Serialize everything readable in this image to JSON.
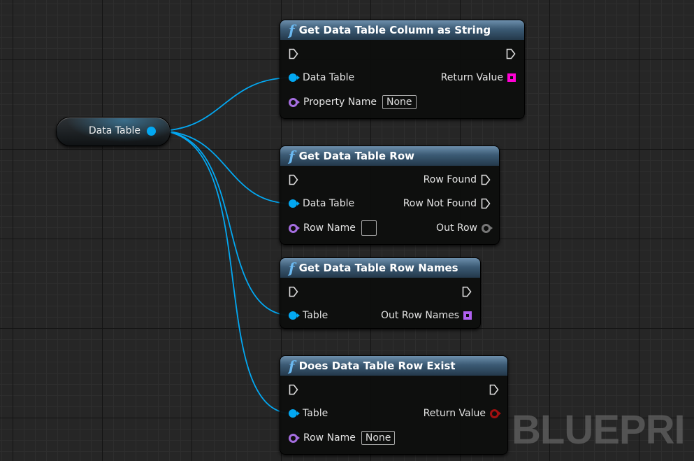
{
  "watermark": "BLUEPRI",
  "variable_node": {
    "label": "Data Table",
    "pin_color": "#03a8f2"
  },
  "nodes": [
    {
      "title": "Get Data Table Column as String",
      "inputs": [
        "Data Table",
        "Property Name"
      ],
      "property_value": "None",
      "outputs": [
        "Return Value"
      ]
    },
    {
      "title": "Get Data Table Row",
      "inputs": [
        "Data Table",
        "Row Name"
      ],
      "outputs": [
        "Row Found",
        "Row Not Found",
        "Out Row"
      ]
    },
    {
      "title": "Get Data Table Row Names",
      "inputs": [
        "Table"
      ],
      "outputs": [
        "Out Row Names"
      ]
    },
    {
      "title": "Does Data Table Row Exist",
      "inputs": [
        "Table",
        "Row Name"
      ],
      "row_name_value": "None",
      "outputs": [
        "Return Value"
      ]
    }
  ],
  "function_icon": "f",
  "colors": {
    "data_table_pin": "#03a8f2",
    "name_pin": "#a56ee0",
    "string_array": "#ff00d4",
    "name_array": "#b060f0",
    "bool_pin": "#a01010",
    "struct_pin": "#777777"
  }
}
